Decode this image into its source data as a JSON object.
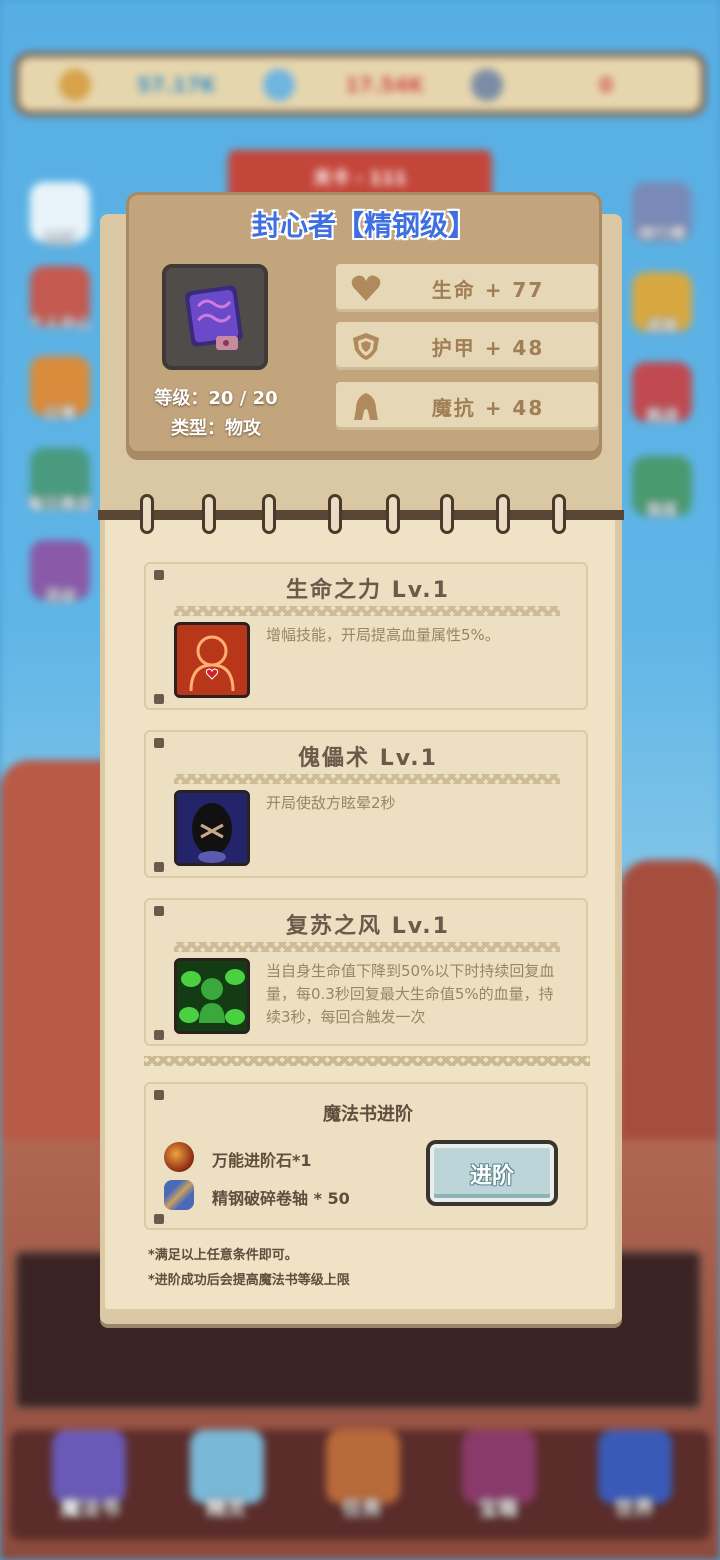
{
  "background": {
    "top_resources": [
      {
        "icon": "gold-coin-icon",
        "value": "57.17K"
      },
      {
        "icon": "crystal-icon",
        "value": "17.54K"
      },
      {
        "icon": "scroll-icon",
        "value": "0"
      }
    ],
    "stage_label": "关卡 - 111",
    "left_menu": [
      "社区",
      "个人中心",
      "日常",
      "每日商店",
      "活动"
    ],
    "right_menu": [
      "排行榜",
      "成就",
      "挑战",
      "保底"
    ],
    "bottom_nav": [
      "魔法书",
      "精灵",
      "任务",
      "宝箱",
      "世界"
    ]
  },
  "modal": {
    "title": "封心者【精钢级】",
    "item": {
      "icon": "magic-book-icon",
      "level_label": "等级：20 / 20",
      "type_label": "类型：物攻"
    },
    "stats": [
      {
        "icon": "heart-icon",
        "label": "生命 + 77"
      },
      {
        "icon": "shield-icon",
        "label": "护甲 + 48"
      },
      {
        "icon": "hood-icon",
        "label": "魔抗 + 48"
      }
    ],
    "skills": [
      {
        "name": "生命之力 Lv.1",
        "icon": "life-force-icon",
        "desc": "增幅技能，开局提高血量属性5%。"
      },
      {
        "name": "傀儡术 Lv.1",
        "icon": "puppet-icon",
        "desc": "开局使敌方眩晕2秒"
      },
      {
        "name": "复苏之风 Lv.1",
        "icon": "revival-wind-icon",
        "desc": "当自身生命值下降到50%以下时持续回复血量，每0.3秒回复最大生命值5%的血量，持续3秒，每回合触发一次"
      }
    ],
    "advance": {
      "title": "魔法书进阶",
      "requirements": [
        {
          "icon": "universal-stone-icon",
          "label": "万能进阶石*1"
        },
        {
          "icon": "steel-scroll-icon",
          "label": "精钢破碎卷轴 * 50"
        }
      ],
      "button_label": "进阶"
    },
    "notes": [
      "*满足以上任意条件即可。",
      "*进阶成功后会提高魔法书等级上限"
    ]
  },
  "colors": {
    "title_blue": "#3f6fe0",
    "stat_text": "#a07e56",
    "page_bg": "#f0e2c4"
  }
}
